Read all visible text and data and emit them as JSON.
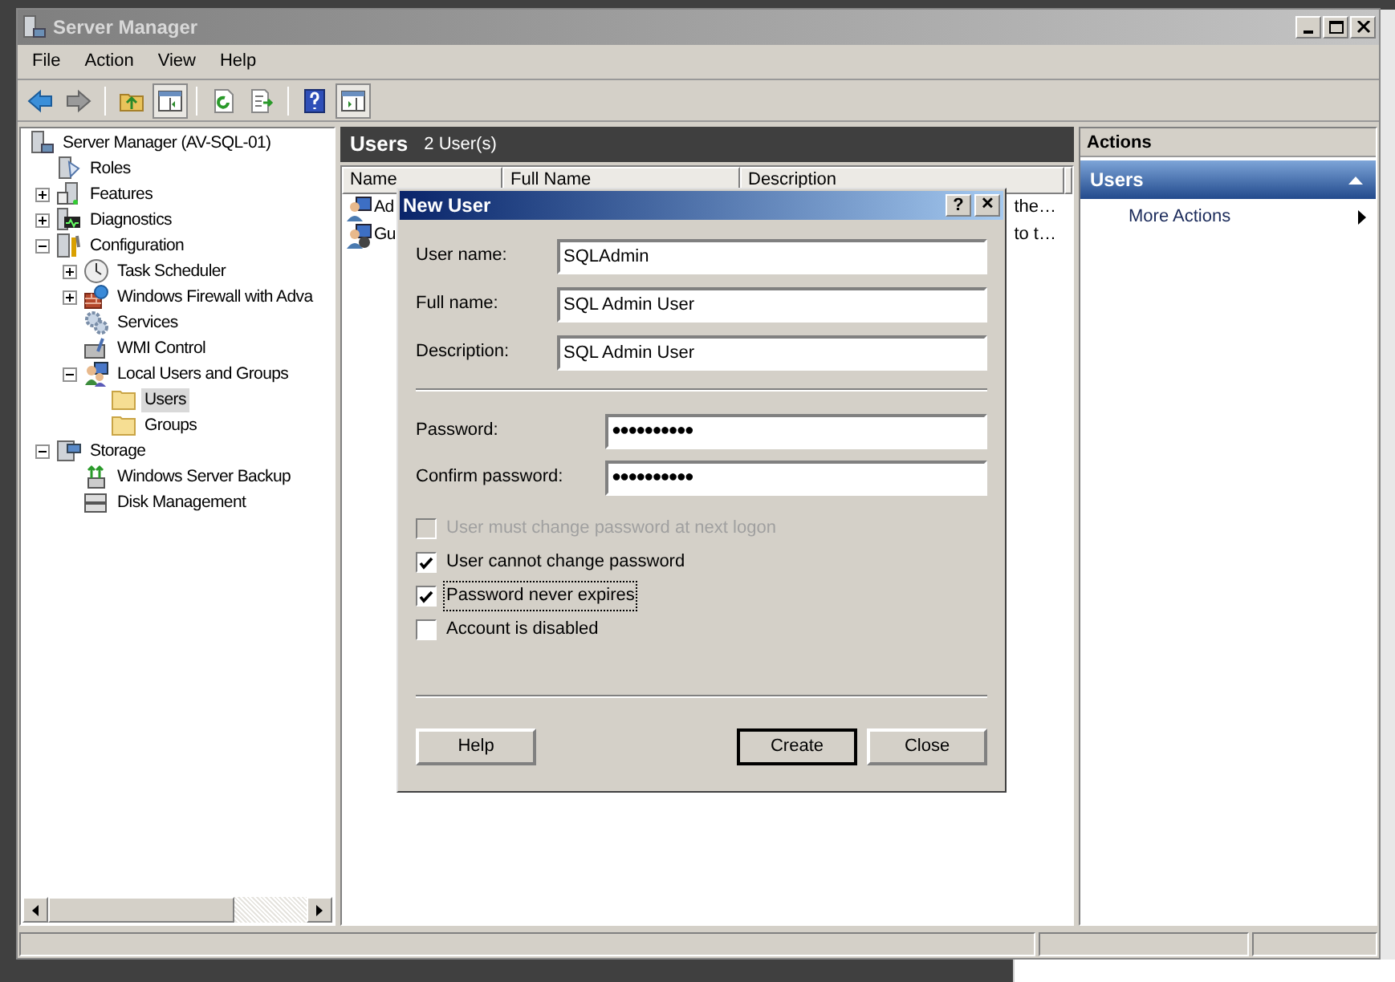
{
  "window": {
    "title": "Server Manager"
  },
  "menu": [
    "File",
    "Action",
    "View",
    "Help"
  ],
  "toolbar": [
    {
      "kind": "back"
    },
    {
      "kind": "forward"
    },
    {
      "kind": "sep"
    },
    {
      "kind": "up"
    },
    {
      "kind": "tree",
      "selected": true
    },
    {
      "kind": "sep"
    },
    {
      "kind": "refresh"
    },
    {
      "kind": "export"
    },
    {
      "kind": "sep"
    },
    {
      "kind": "help"
    },
    {
      "kind": "pane",
      "selected": true
    }
  ],
  "tree": [
    {
      "label": "Server Manager (AV-SQL-01)",
      "kind": "server",
      "selected": false,
      "children": [
        {
          "label": "Roles",
          "kind": "roles",
          "selected": false
        },
        {
          "label": "Features",
          "kind": "features",
          "selected": false,
          "expanded": false
        },
        {
          "label": "Diagnostics",
          "kind": "diag",
          "selected": false,
          "expanded": false
        },
        {
          "label": "Configuration",
          "kind": "config",
          "selected": false,
          "expanded": true,
          "children": [
            {
              "label": "Task Scheduler",
              "kind": "clock",
              "selected": false,
              "expanded": false
            },
            {
              "label": "Windows Firewall with Adva",
              "kind": "firewall",
              "selected": false,
              "expanded": false
            },
            {
              "label": "Services",
              "kind": "gear",
              "selected": false
            },
            {
              "label": "WMI Control",
              "kind": "wmi",
              "selected": false
            },
            {
              "label": "Local Users and Groups",
              "kind": "users",
              "selected": false,
              "expanded": true,
              "children": [
                {
                  "label": "Users",
                  "kind": "folder",
                  "selected": true
                },
                {
                  "label": "Groups",
                  "kind": "folder",
                  "selected": false
                }
              ]
            }
          ]
        },
        {
          "label": "Storage",
          "kind": "storage",
          "selected": false,
          "expanded": true,
          "children": [
            {
              "label": "Windows Server Backup",
              "kind": "backup",
              "selected": false
            },
            {
              "label": "Disk Management",
              "kind": "disk",
              "selected": false
            }
          ]
        }
      ]
    }
  ],
  "content": {
    "title": "Users",
    "count": "2 User(s)",
    "columns": [
      "Name",
      "Full Name",
      "Description"
    ],
    "rows": [
      {
        "name": "Ad",
        "description": "the…",
        "kind": "admin"
      },
      {
        "name": "Gu",
        "description": "to t…",
        "kind": "guest"
      }
    ]
  },
  "actions": {
    "title": "Actions",
    "section": "Users",
    "expanded": true,
    "items": [
      "More Actions"
    ]
  },
  "dialog": {
    "title": "New User",
    "help": "?",
    "close": "✕",
    "fields": [
      {
        "label": "User name:",
        "value": "SQLAdmin",
        "kind": "text"
      },
      {
        "label": "Full name:",
        "value": "SQL Admin User",
        "kind": "text"
      },
      {
        "label": "Description:",
        "value": "SQL Admin User",
        "kind": "text"
      },
      {
        "label": "Password:",
        "value": "●●●●●●●●●●",
        "kind": "password"
      },
      {
        "label": "Confirm password:",
        "value": "●●●●●●●●●●",
        "kind": "password"
      }
    ],
    "options": [
      {
        "label": "User must change password at next logon",
        "checked": false,
        "disabled": true,
        "focused": false
      },
      {
        "label": "User cannot change password",
        "checked": true,
        "disabled": false,
        "focused": false
      },
      {
        "label": "Password never expires",
        "checked": true,
        "disabled": false,
        "focused": true
      },
      {
        "label": "Account is disabled",
        "checked": false,
        "disabled": false,
        "focused": false
      }
    ],
    "buttons": [
      {
        "label": "Help",
        "default": false
      },
      {
        "label": "Create",
        "default": true
      },
      {
        "label": "Close",
        "default": false
      }
    ]
  }
}
